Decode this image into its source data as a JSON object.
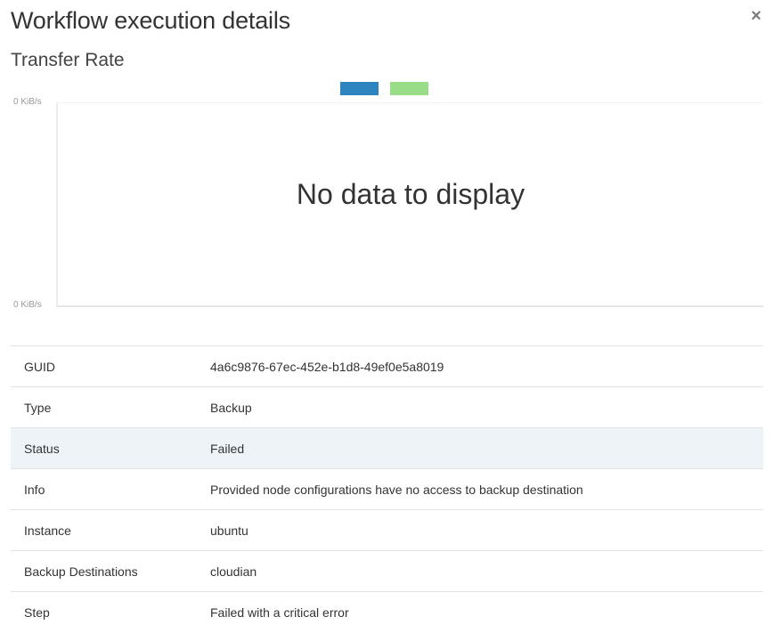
{
  "modal": {
    "title": "Workflow execution details",
    "close_label": "×"
  },
  "chart_section": {
    "title": "Transfer Rate"
  },
  "chart_data": {
    "type": "line",
    "title": "",
    "xlabel": "",
    "ylabel": "",
    "y_ticks": [
      "0 KiB/s",
      "0 KiB/s"
    ],
    "series": [
      {
        "values": [],
        "color": "#2e84be"
      },
      {
        "values": [],
        "color": "#99dd88"
      }
    ],
    "empty_message": "No data to display"
  },
  "details": {
    "rows": [
      {
        "key": "GUID",
        "value": "4a6c9876-67ec-452e-b1d8-49ef0e5a8019"
      },
      {
        "key": "Type",
        "value": "Backup"
      },
      {
        "key": "Status",
        "value": "Failed"
      },
      {
        "key": "Info",
        "value": "Provided node configurations have no access to backup destination"
      },
      {
        "key": "Instance",
        "value": "ubuntu"
      },
      {
        "key": "Backup Destinations",
        "value": "cloudian"
      },
      {
        "key": "Step",
        "value": "Failed with a critical error"
      }
    ]
  }
}
